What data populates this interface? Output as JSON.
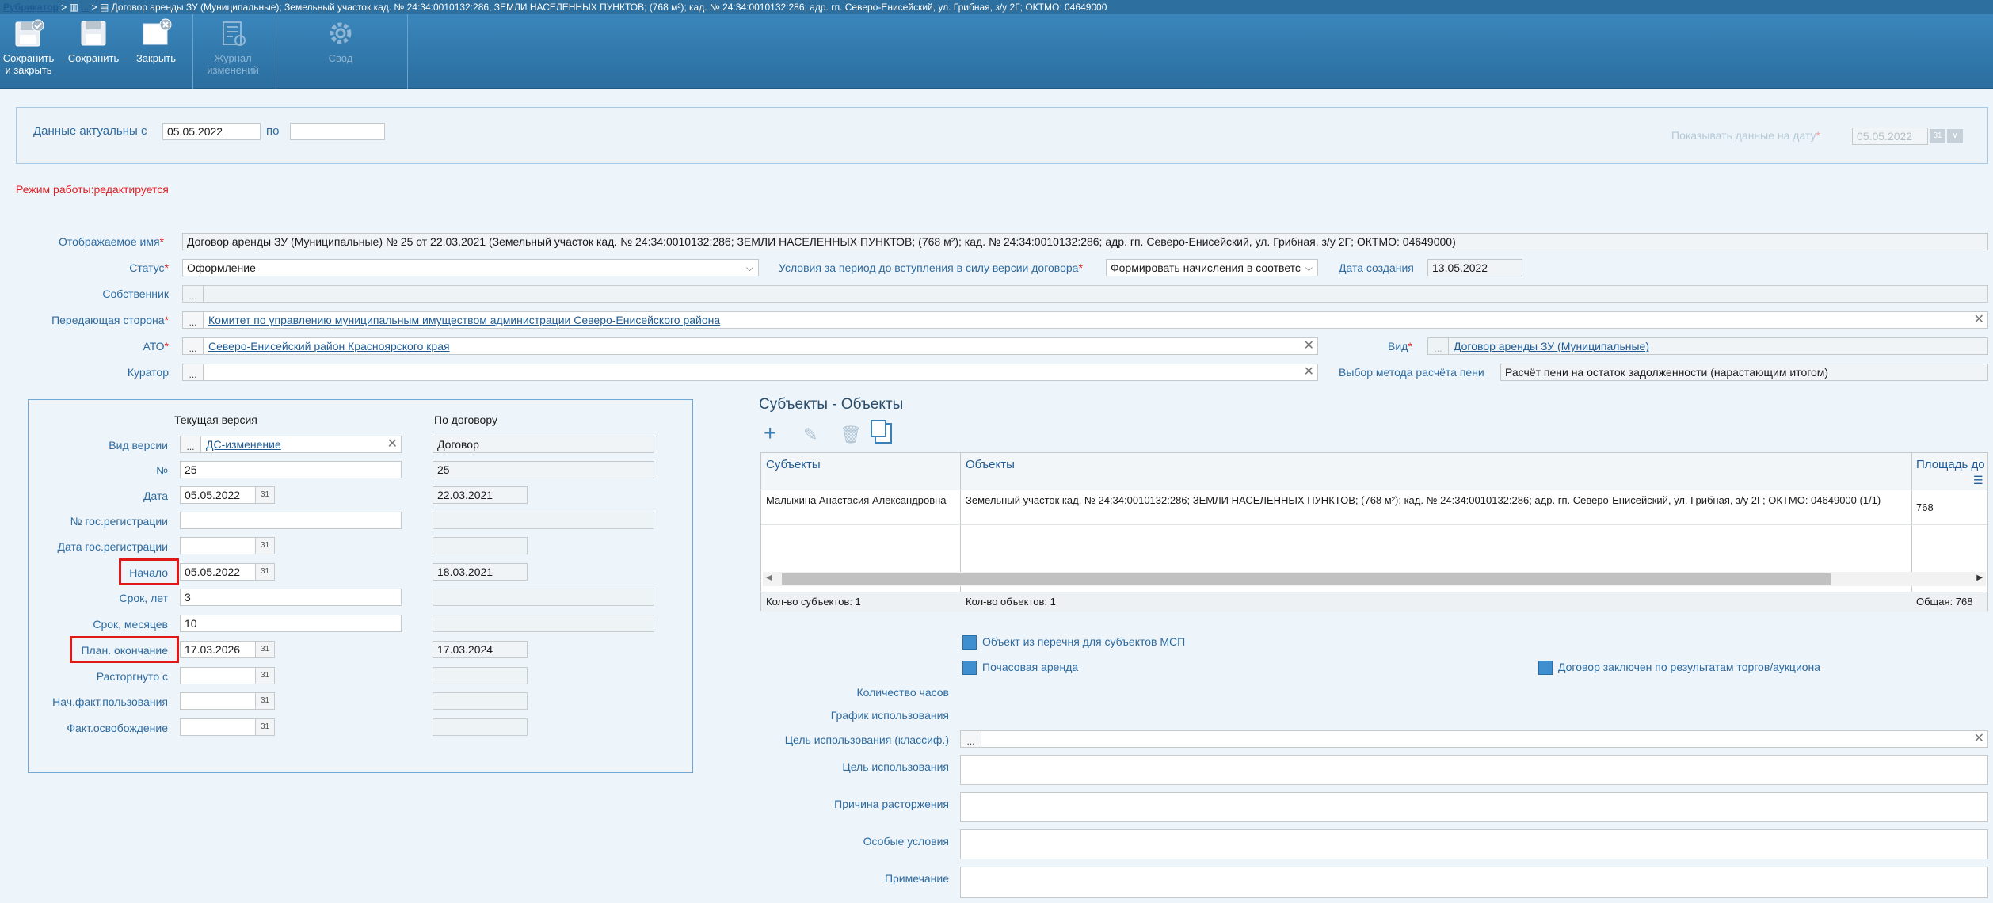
{
  "titlebar": {
    "root": "Рубрикатор",
    "sep1": ">",
    "crumb2": "...",
    "sep2": ">",
    "current": "Договор аренды ЗУ (Муниципальные); Земельный участок кад. № 24:34:0010132:286; ЗЕМЛИ НАСЕЛЕННЫХ ПУНКТОВ; (768 м²); кад. № 24:34:0010132:286; адр. гп. Северо-Енисейский, ул. Грибная, з/у 2Г; ОКТМО: 04649000"
  },
  "toolbar": {
    "save_close_line1": "Сохранить",
    "save_close_line2": "и закрыть",
    "save": "Сохранить",
    "close": "Закрыть",
    "journal_line1": "Журнал",
    "journal_line2": "изменений",
    "svod": "Свод"
  },
  "actual": {
    "label_from": "Данные актуальны с",
    "from": "05.05.2022",
    "label_to": "по",
    "to": "",
    "show_date_label": "Показывать данные на дату",
    "show_date_value": "05.05.2022"
  },
  "mode": "Режим работы:редактируется",
  "fields": {
    "display_name_label": "Отображаемое имя",
    "display_name": "Договор аренды ЗУ (Муниципальные) № 25 от 22.03.2021 (Земельный участок кад. № 24:34:0010132:286; ЗЕМЛИ НАСЕЛЕННЫХ ПУНКТОВ; (768 м²); кад. № 24:34:0010132:286; адр. гп. Северо-Енисейский, ул. Грибная, з/у 2Г; ОКТМО: 04649000)",
    "status_label": "Статус",
    "status": "Оформление",
    "conditions_label": "Условия за период до вступления в силу версии договора",
    "conditions": "Формировать начисления в соответс",
    "created_label": "Дата создания",
    "created": "13.05.2022",
    "owner_label": "Собственник",
    "transferring_label": "Передающая сторона",
    "transferring": "Комитет по управлению муниципальным имуществом администрации Северо-Енисейского района",
    "ato_label": "АТО",
    "ato": "Северо-Енисейский район Красноярского края",
    "kind_label": "Вид",
    "kind": "Договор аренды ЗУ (Муниципальные)",
    "curator_label": "Куратор",
    "penalty_label": "Выбор метода расчёта пени",
    "penalty": "Расчёт пени на остаток задолженности (нарастающим итогом)"
  },
  "version": {
    "col_current": "Текущая версия",
    "col_contract": "По договору",
    "rows": [
      {
        "label": "Вид версии",
        "current": "ДС-изменение",
        "contract": "Договор"
      },
      {
        "label": "№",
        "current": "25",
        "contract": "25"
      },
      {
        "label": "Дата",
        "current": "05.05.2022",
        "contract": "22.03.2021"
      },
      {
        "label": "№ гос.регистрации",
        "current": "",
        "contract": ""
      },
      {
        "label": "Дата гос.регистрации",
        "current": "",
        "contract": ""
      },
      {
        "label": "Начало",
        "current": "05.05.2022",
        "contract": "18.03.2021"
      },
      {
        "label": "Срок, лет",
        "current": "3",
        "contract": ""
      },
      {
        "label": "Срок, месяцев",
        "current": "10",
        "contract": ""
      },
      {
        "label": "План. окончание",
        "current": "17.03.2026",
        "contract": "17.03.2024"
      },
      {
        "label": "Расторгнуто с",
        "current": "",
        "contract": ""
      },
      {
        "label": "Нач.факт.пользования",
        "current": "",
        "contract": ""
      },
      {
        "label": "Факт.освобождение",
        "current": "",
        "contract": ""
      }
    ]
  },
  "subjects": {
    "title": "Субъекты - Объекты",
    "headers": [
      "Субъекты",
      "Объекты",
      "Площадь до"
    ],
    "row": {
      "subject": "Малыхина Анастасия Александровна",
      "object": "Земельный участок кад. № 24:34:0010132:286; ЗЕМЛИ НАСЕЛЕННЫХ ПУНКТОВ; (768 м²); кад. № 24:34:0010132:286; адр. гп. Северо-Енисейский, ул. Грибная, з/у 2Г; ОКТМО: 04649000 (1/1)",
      "area": "768"
    },
    "footer": {
      "subjects_count": "Кол-во субъектов: 1",
      "objects_count": "Кол-во объектов: 1",
      "total": "Общая: 768"
    }
  },
  "flags": {
    "msp": "Объект из перечня для субъектов МСП",
    "hourly": "Почасовая аренда",
    "auction": "Договор заключен по результатам торгов/аукциона"
  },
  "extra": {
    "hours_label": "Количество часов",
    "schedule_label": "График использования",
    "purpose_class_label": "Цель использования (классиф.)",
    "purpose_label": "Цель использования",
    "termination_label": "Причина расторжения",
    "special_label": "Особые условия",
    "note_label": "Примечание"
  },
  "colors": {
    "toolbar": "#2d6f9e",
    "label": "#2d6aa0",
    "required": "#e02020",
    "highlight": "#e01818"
  }
}
